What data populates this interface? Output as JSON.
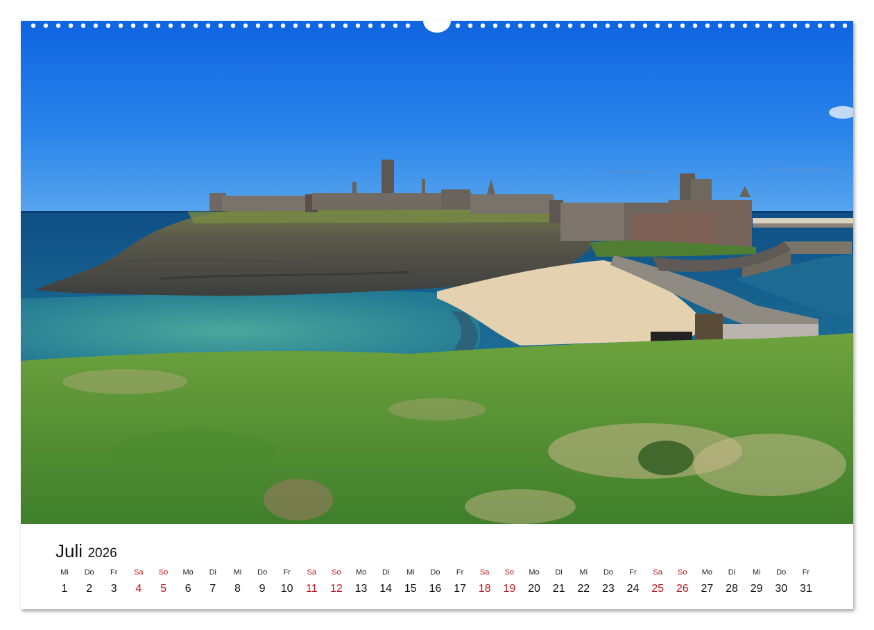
{
  "calendar": {
    "month": "Juli",
    "year": "2026",
    "weekend_color": "#c0171c",
    "days": [
      {
        "weekday": "Mi",
        "day": "1",
        "weekend": false
      },
      {
        "weekday": "Do",
        "day": "2",
        "weekend": false
      },
      {
        "weekday": "Fr",
        "day": "3",
        "weekend": false
      },
      {
        "weekday": "Sa",
        "day": "4",
        "weekend": true
      },
      {
        "weekday": "So",
        "day": "5",
        "weekend": true
      },
      {
        "weekday": "Mo",
        "day": "6",
        "weekend": false
      },
      {
        "weekday": "Di",
        "day": "7",
        "weekend": false
      },
      {
        "weekday": "Mi",
        "day": "8",
        "weekend": false
      },
      {
        "weekday": "Do",
        "day": "9",
        "weekend": false
      },
      {
        "weekday": "Fr",
        "day": "10",
        "weekend": false
      },
      {
        "weekday": "Sa",
        "day": "11",
        "weekend": true
      },
      {
        "weekday": "So",
        "day": "12",
        "weekend": true
      },
      {
        "weekday": "Mo",
        "day": "13",
        "weekend": false
      },
      {
        "weekday": "Di",
        "day": "14",
        "weekend": false
      },
      {
        "weekday": "Mi",
        "day": "15",
        "weekend": false
      },
      {
        "weekday": "Do",
        "day": "16",
        "weekend": false
      },
      {
        "weekday": "Fr",
        "day": "17",
        "weekend": false
      },
      {
        "weekday": "Sa",
        "day": "18",
        "weekend": true
      },
      {
        "weekday": "So",
        "day": "19",
        "weekend": true
      },
      {
        "weekday": "Mo",
        "day": "20",
        "weekend": false
      },
      {
        "weekday": "Di",
        "day": "21",
        "weekend": false
      },
      {
        "weekday": "Mi",
        "day": "22",
        "weekend": false
      },
      {
        "weekday": "Do",
        "day": "23",
        "weekend": false
      },
      {
        "weekday": "Fr",
        "day": "24",
        "weekend": false
      },
      {
        "weekday": "Sa",
        "day": "25",
        "weekend": true
      },
      {
        "weekday": "So",
        "day": "26",
        "weekend": true
      },
      {
        "weekday": "Mo",
        "day": "27",
        "weekend": false
      },
      {
        "weekday": "Di",
        "day": "28",
        "weekend": false
      },
      {
        "weekday": "Mi",
        "day": "29",
        "weekend": false
      },
      {
        "weekday": "Do",
        "day": "30",
        "weekend": false
      },
      {
        "weekday": "Fr",
        "day": "31",
        "weekend": false
      }
    ]
  },
  "photo": {
    "subject": "castle-ruins-on-island-with-beach-and-harbour",
    "colors": {
      "sky_top": "#1470e6",
      "sky_horizon": "#4a9bea",
      "sea": "#1f6f96",
      "lagoon": "#3e9c9e",
      "grass": "#4f8f2f",
      "sand": "#e6d3b3",
      "stone": "#6f6862"
    }
  }
}
